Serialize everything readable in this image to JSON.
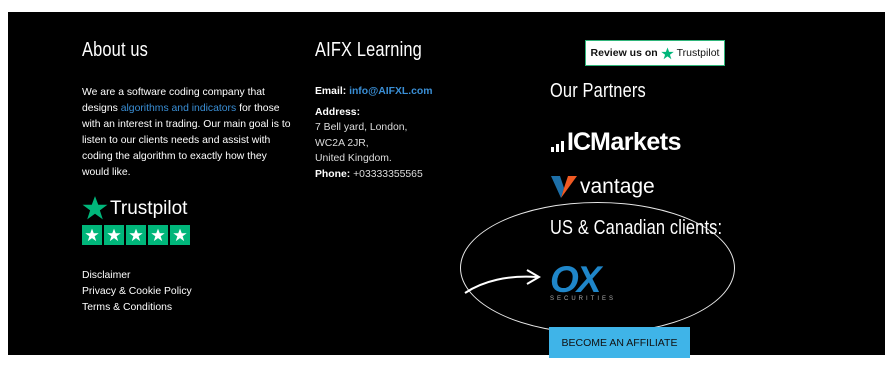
{
  "about": {
    "heading": "About us",
    "text_1": "We are a software coding company that designs ",
    "link": "algorithms and indicators",
    "text_2": " for those with an interest in trading. Our main goal is to listen to our clients needs and assist with coding the algorithm to exactly how they would like.",
    "trustpilot_label": "Trustpilot",
    "trustpilot_stars": 5,
    "links": [
      "Disclaimer",
      "Privacy & Cookie Policy",
      "Terms & Conditions"
    ]
  },
  "learning": {
    "heading": "AIFX Learning",
    "email_label": "Email:",
    "email": "info@AIFXL.com",
    "address_label": "Address:",
    "address_lines": [
      "7 Bell yard, London,",
      "WC2A 2JR,",
      "United Kingdom."
    ],
    "phone_label": "Phone:",
    "phone": "+03333355565"
  },
  "partners": {
    "review_prefix": "Review us on",
    "review_brand": "Trustpilot",
    "heading": "Our Partners",
    "icmarkets_ic": "IC",
    "icmarkets_rest": "Markets",
    "vantage": "vantage",
    "us_heading": "US & Canadian clients:",
    "ox_logo": "OX",
    "ox_sub": "SECURITIES",
    "affiliate_button": "BECOME AN AFFILIATE"
  },
  "colors": {
    "background": "#000000",
    "link": "#3a8fd6",
    "trustpilot_green": "#00b67a",
    "affiliate_button": "#3fb4e8",
    "vantage_orange": "#f05a23",
    "vantage_blue": "#1d6fa8"
  }
}
